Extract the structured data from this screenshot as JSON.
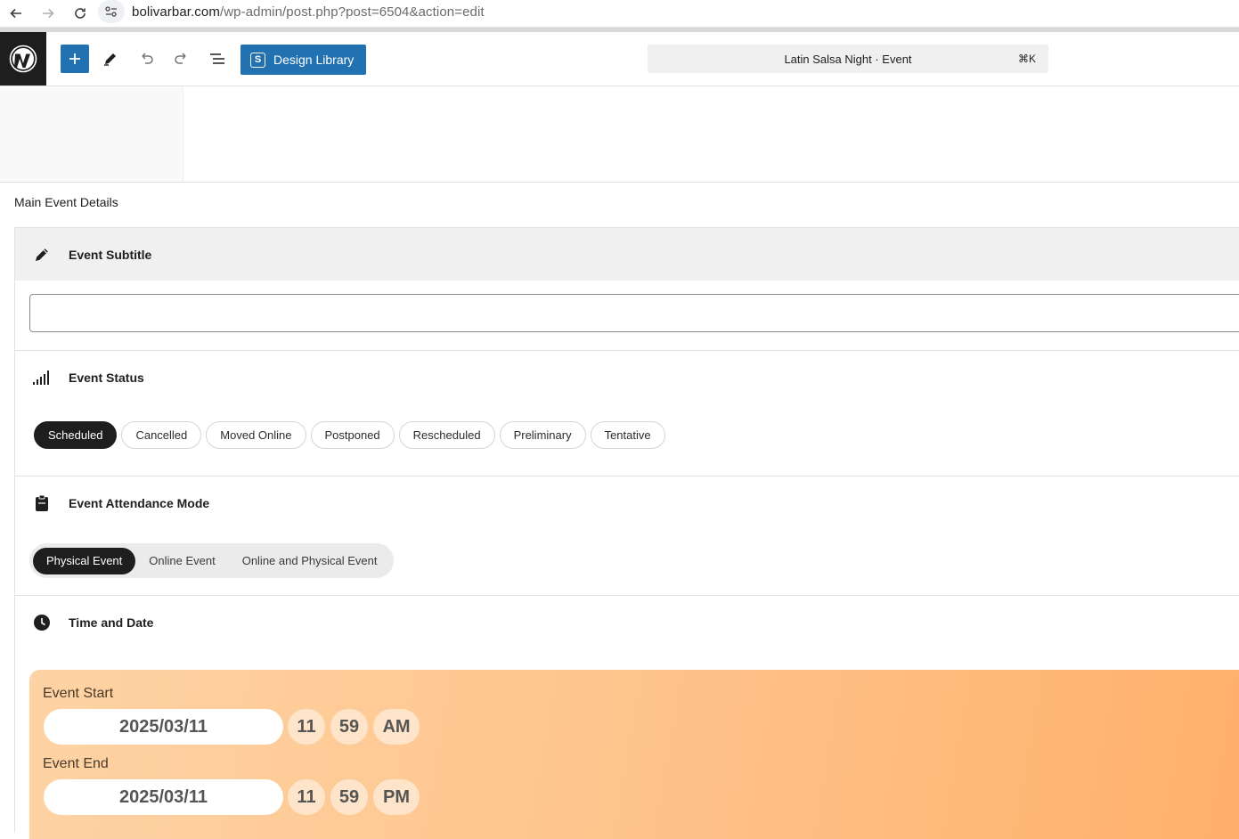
{
  "browser": {
    "url_host": "bolivarbar.com",
    "url_path": "/wp-admin/post.php?post=6504&action=edit"
  },
  "toolbar": {
    "design_library_label": "Design Library",
    "command_title": "Latin Salsa Night · Event",
    "command_shortcut": "⌘K"
  },
  "meta": {
    "title": "Main Event Details"
  },
  "subtitle": {
    "label": "Event Subtitle",
    "value": ""
  },
  "status": {
    "label": "Event Status",
    "options": [
      "Scheduled",
      "Cancelled",
      "Moved Online",
      "Postponed",
      "Rescheduled",
      "Preliminary",
      "Tentative"
    ],
    "selected": "Scheduled"
  },
  "attendance": {
    "label": "Event Attendance Mode",
    "options": [
      "Physical Event",
      "Online Event",
      "Online and Physical Event"
    ],
    "selected": "Physical Event"
  },
  "time": {
    "label": "Time and Date",
    "start_label": "Event Start",
    "start_date": "2025/03/11",
    "start_hour": "11",
    "start_minute": "59",
    "start_ampm": "AM",
    "end_label": "Event End",
    "end_date": "2025/03/11",
    "end_hour": "11",
    "end_minute": "59",
    "end_ampm": "PM"
  },
  "colors": {
    "wp_blue": "#2271b1",
    "chip_active": "#1e1e1e",
    "time_gradient_start": "#fed3a4",
    "time_gradient_end": "#ffb06a"
  }
}
